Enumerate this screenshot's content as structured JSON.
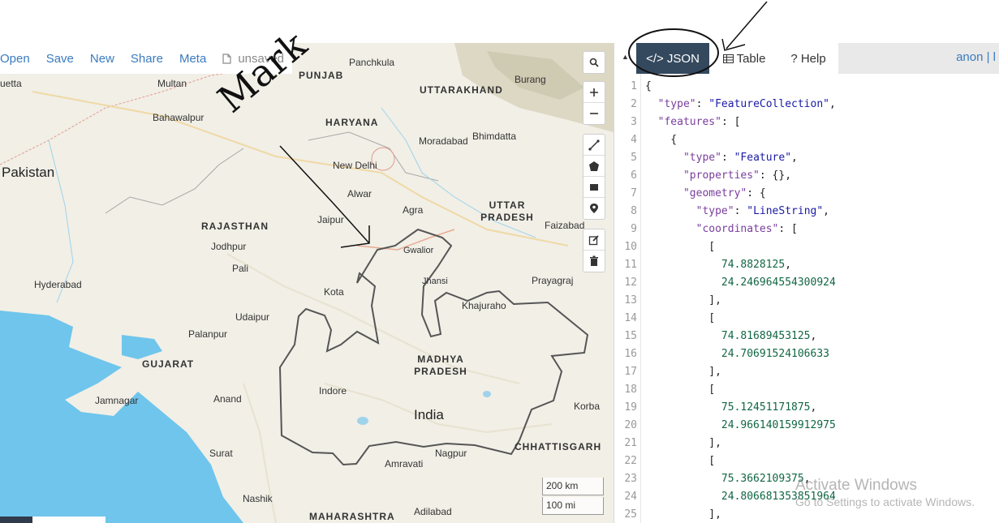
{
  "file_menu": {
    "open": "Open",
    "save": "Save",
    "new": "New",
    "share": "Share",
    "meta": "Meta",
    "status": "unsaved"
  },
  "panel": {
    "tabs": {
      "json": "</> JSON",
      "table": "Table",
      "help": "? Help"
    },
    "user": "anon | l"
  },
  "map": {
    "labels": {
      "cities": [
        {
          "name": "Panchkula"
        },
        {
          "name": "Burang"
        },
        {
          "name": "Multan"
        },
        {
          "name": "uetta"
        },
        {
          "name": "Bahawalpur"
        },
        {
          "name": "Moradabad"
        },
        {
          "name": "Bhimdatta"
        },
        {
          "name": "New Delhi"
        },
        {
          "name": "Alwar"
        },
        {
          "name": "Agra"
        },
        {
          "name": "Jaipur"
        },
        {
          "name": "Faizabad"
        },
        {
          "name": "Jodhpur"
        },
        {
          "name": "Gwalior"
        },
        {
          "name": "Pali"
        },
        {
          "name": "Jhansi"
        },
        {
          "name": "Prayagraj"
        },
        {
          "name": "Hyderabad"
        },
        {
          "name": "Kota"
        },
        {
          "name": "Khajuraho"
        },
        {
          "name": "Udaipur"
        },
        {
          "name": "Palanpur"
        },
        {
          "name": "Indore"
        },
        {
          "name": "Jamnagar"
        },
        {
          "name": "Anand"
        },
        {
          "name": "Korba"
        },
        {
          "name": "Surat"
        },
        {
          "name": "Amravati"
        },
        {
          "name": "Nagpur"
        },
        {
          "name": "Nashik"
        },
        {
          "name": "Adilabad"
        }
      ],
      "states": [
        "PUNJAB",
        "UTTARAKHAND",
        "HARYANA",
        "UTTAR PRADESH",
        "RAJASTHAN",
        "MADHYA PRADESH",
        "GUJARAT",
        "CHHATTISGARH",
        "MAHARASHTRA"
      ],
      "countries": [
        "Pakistan",
        "India"
      ]
    },
    "scale": {
      "km": "200 km",
      "mi": "100 mi"
    },
    "handwriting": "Mark"
  },
  "editor": {
    "lines": [
      "{",
      "  \"type\": \"FeatureCollection\",",
      "  \"features\": [",
      "    {",
      "      \"type\": \"Feature\",",
      "      \"properties\": {},",
      "      \"geometry\": {",
      "        \"type\": \"LineString\",",
      "        \"coordinates\": [",
      "          [",
      "            74.8828125,",
      "            24.246964554300924",
      "          ],",
      "          [",
      "            74.81689453125,",
      "            24.70691524106633",
      "          ],",
      "          [",
      "            75.12451171875,",
      "            24.966140159912975",
      "          ],",
      "          [",
      "            75.3662109375,",
      "            24.806681353851964",
      "          ],"
    ]
  },
  "watermark": {
    "title": "Activate Windows",
    "subtitle": "Go to Settings to activate Windows."
  }
}
